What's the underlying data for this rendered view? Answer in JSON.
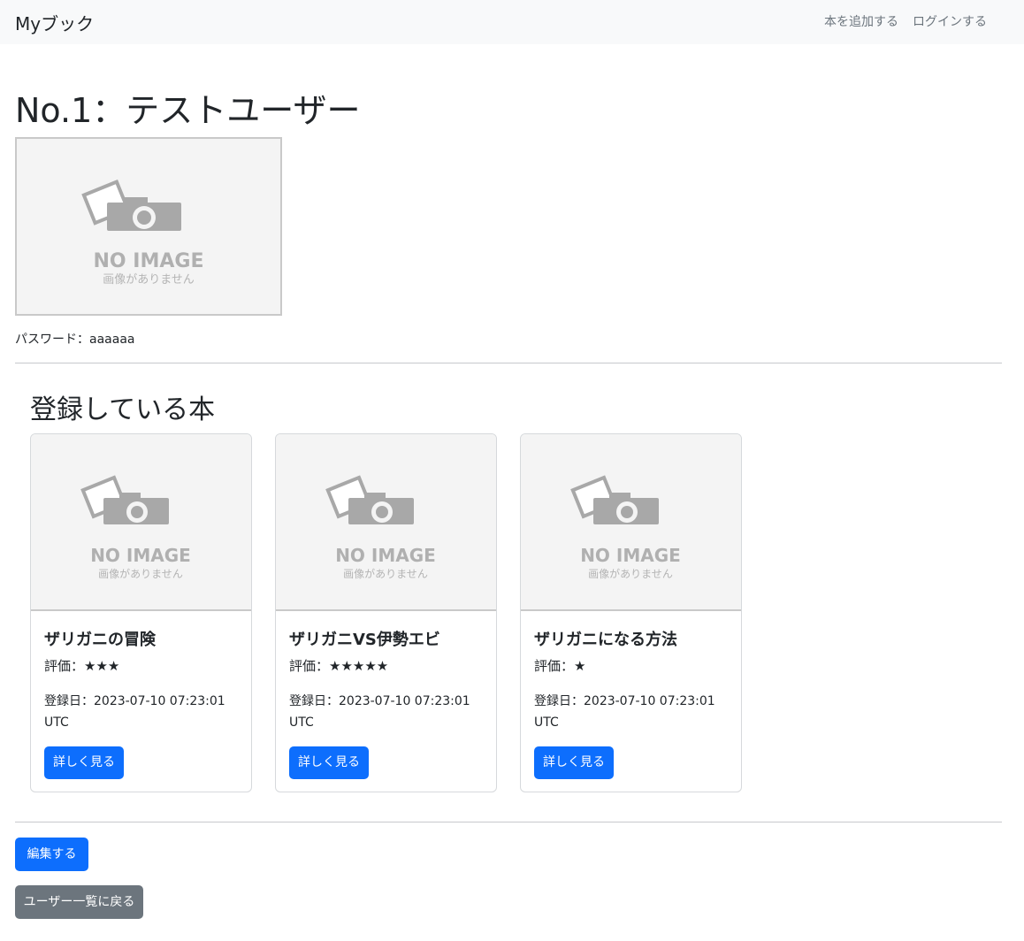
{
  "navbar": {
    "brand": "Myブック",
    "links": [
      "本を追加する",
      "ログインする"
    ]
  },
  "user": {
    "title": "No.1：テストユーザー",
    "password_row": "パスワード：aaaaaa",
    "image": {
      "main_text": "NO IMAGE",
      "sub_text": "画像がありません"
    }
  },
  "books_section": {
    "title": "登録している本",
    "books": [
      {
        "title": "ザリガニの冒険",
        "rating": "評価：★★★",
        "date": "登録日：2023-07-10 07:23:01 UTC",
        "button": "詳しく見る"
      },
      {
        "title": "ザリガニVS伊勢エビ",
        "rating": "評価：★★★★★",
        "date": "登録日：2023-07-10 07:23:01 UTC",
        "button": "詳しく見る"
      },
      {
        "title": "ザリガニになる方法",
        "rating": "評価：★",
        "date": "登録日：2023-07-10 07:23:01 UTC",
        "button": "詳しく見る"
      }
    ]
  },
  "actions": {
    "edit": "編集する",
    "back": "ユーザー一覧に戻る"
  },
  "colors": {
    "primary": "#0d6efd",
    "secondary": "#6c757d",
    "navbar_bg": "#f8f9fa"
  },
  "icons": {
    "placeholder": "camera-icon"
  }
}
